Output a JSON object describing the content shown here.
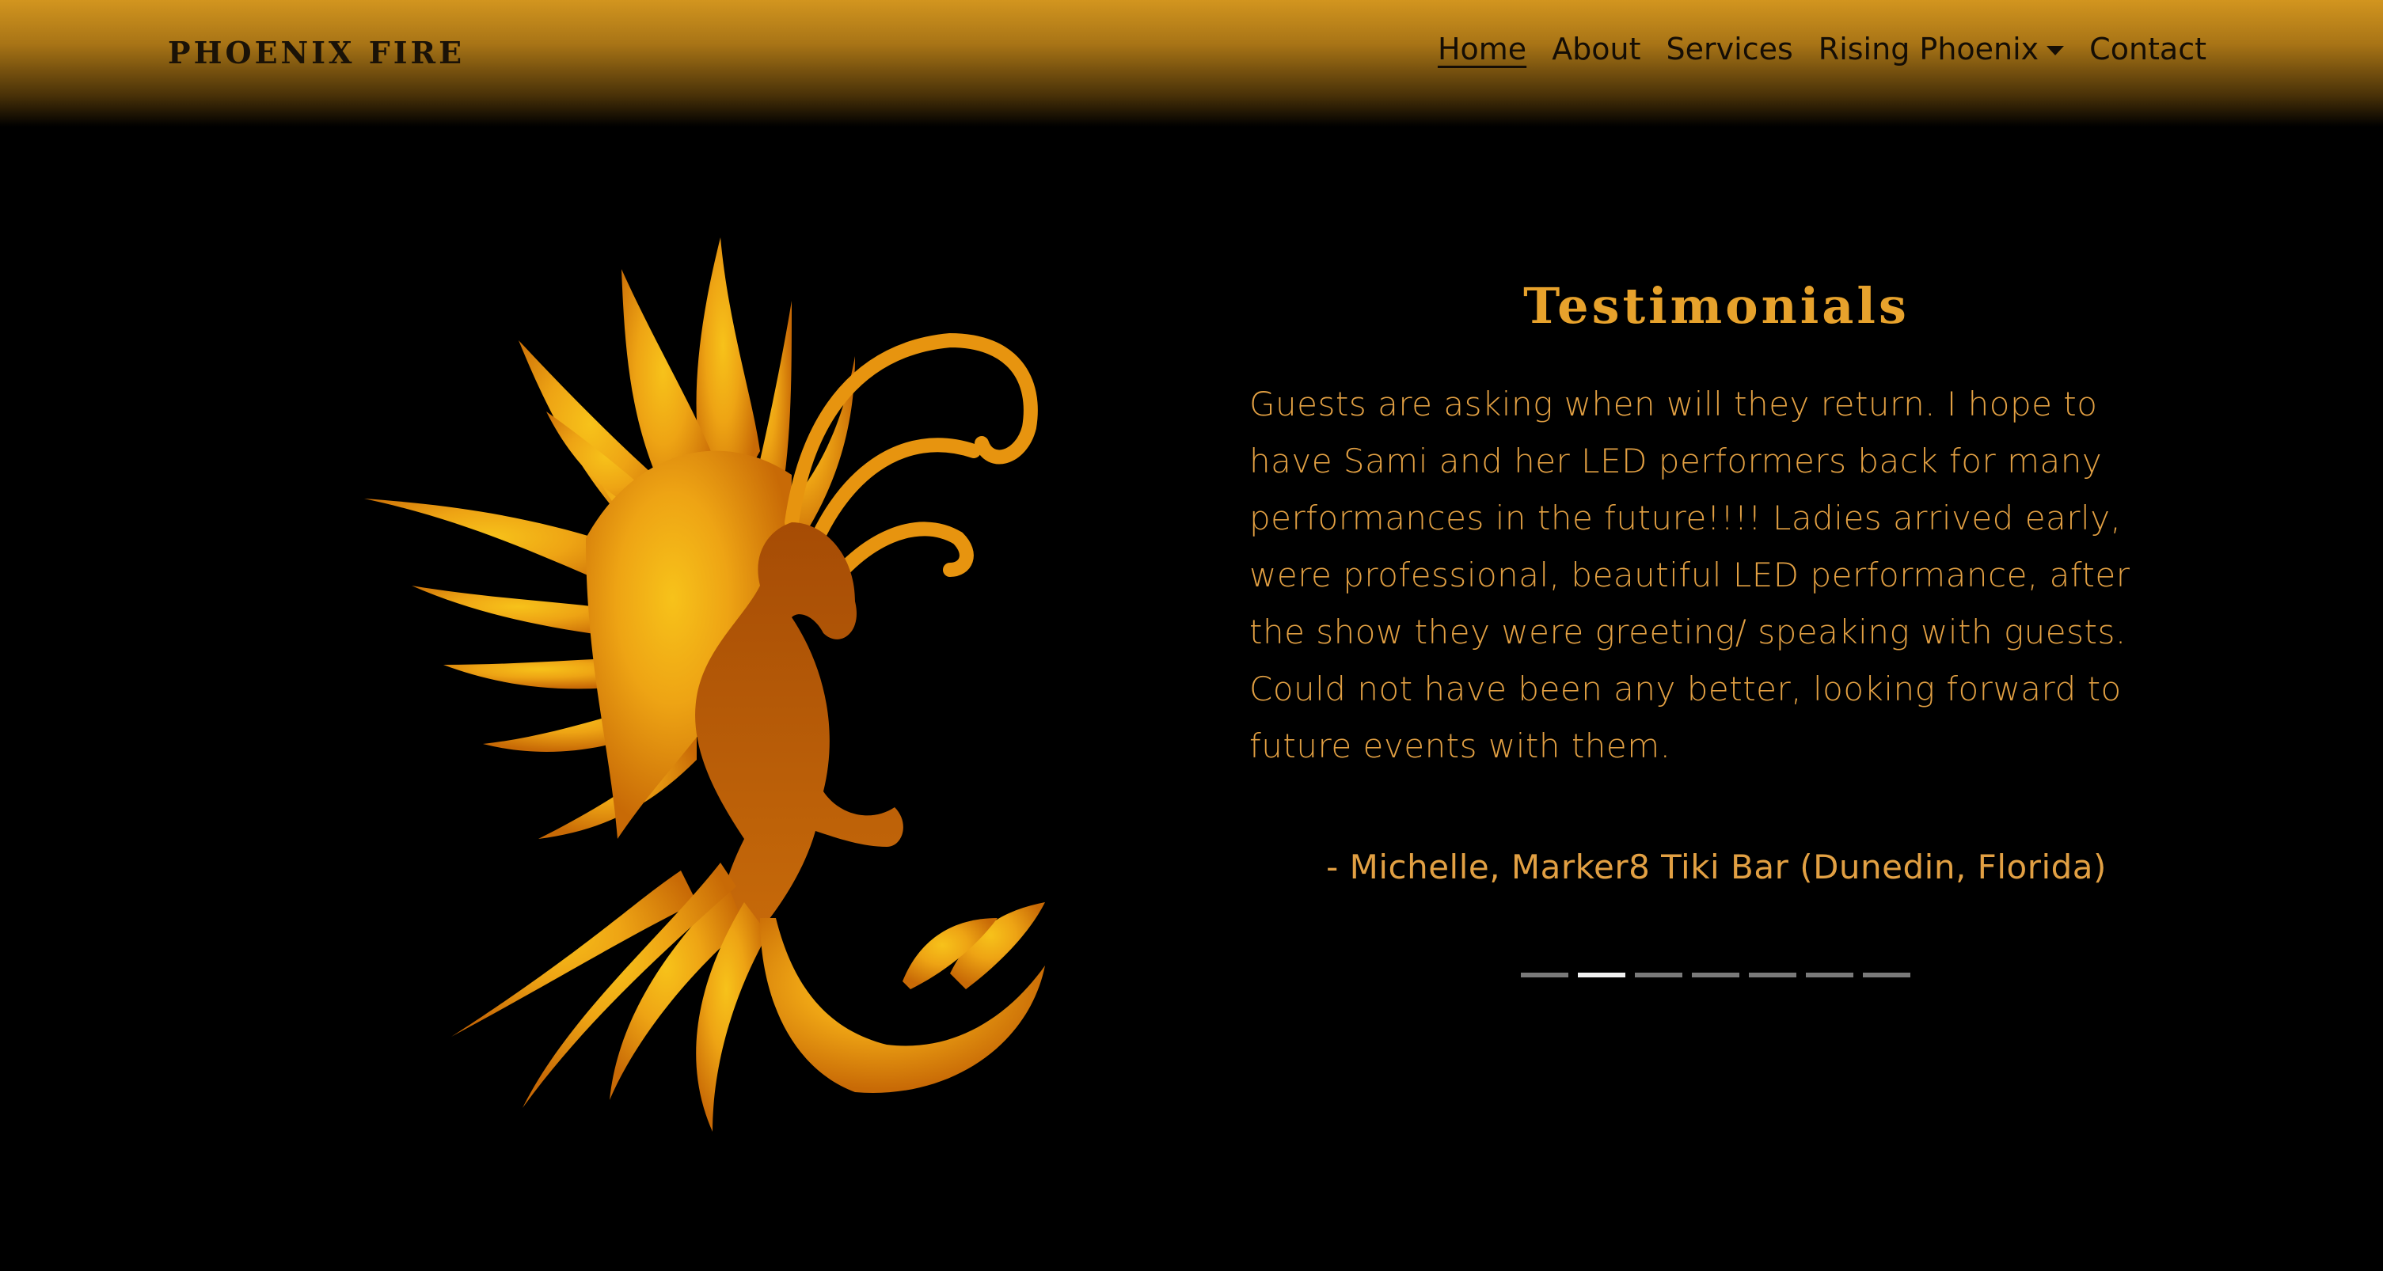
{
  "navbar": {
    "brand": "PHOENIX FIRE",
    "links": [
      {
        "label": "Home",
        "active": true
      },
      {
        "label": "About"
      },
      {
        "label": "Services"
      },
      {
        "label": "Rising Phoenix",
        "dropdown": true
      },
      {
        "label": "Contact"
      }
    ],
    "dropdown_icon": "caret-down-icon"
  },
  "hero_image": {
    "icon": "phoenix-logo-icon"
  },
  "testimonials": {
    "title": "Testimonials",
    "quote": "Guests are asking when will they return. I hope to have Sami and her LED performers back for many performances in the future!!!! Ladies arrived early, were professional, beautiful LED performance, after the show they were greeting/ speaking with guests. Could not have been any better, looking forward to future events with them.",
    "attribution": "- Michelle, Marker8 Tiki Bar (Dunedin, Florida)",
    "carousel": {
      "slide_count": 7,
      "active_index": 1
    }
  },
  "colors": {
    "accent": "#e7a22c",
    "text": "#e2a043",
    "nav_gradient_top": "#d2951f",
    "background": "#000000",
    "indicator_inactive": "#7a7a7a",
    "indicator_active": "#f1f1f1"
  }
}
